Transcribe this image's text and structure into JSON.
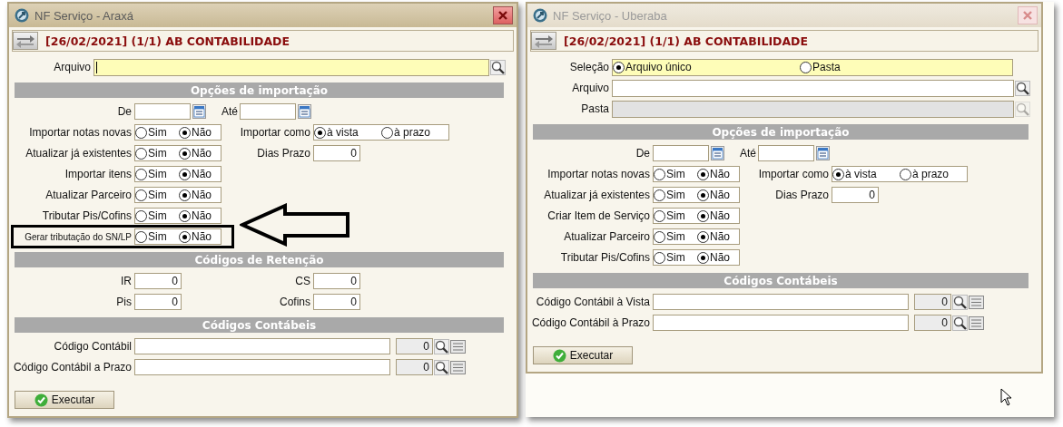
{
  "windows": [
    {
      "title": "NF Serviço - Araxá",
      "active": true,
      "header": "[26/02/2021] (1/1) AB CONTABILIDADE",
      "top_rows": [
        {
          "kind": "file",
          "label": "Arquivo",
          "highlighted": true,
          "disabled": false
        }
      ],
      "sections": [
        {
          "title": "Opções de importação",
          "rows": [
            {
              "boxed": false,
              "cells": [
                {
                  "kind": "date",
                  "label": "De"
                },
                {
                  "kind": "date",
                  "label": "Até"
                }
              ]
            },
            {
              "boxed": false,
              "cells": [
                {
                  "kind": "radio",
                  "label": "Importar notas novas",
                  "options": [
                    {
                      "label": "Sim",
                      "selected": false
                    },
                    {
                      "label": "Não",
                      "selected": true
                    }
                  ]
                },
                {
                  "kind": "radio",
                  "label": "Importar como",
                  "options": [
                    {
                      "label": "à vista",
                      "selected": true
                    },
                    {
                      "label": "à prazo",
                      "selected": false
                    }
                  ]
                }
              ]
            },
            {
              "boxed": false,
              "cells": [
                {
                  "kind": "radio",
                  "label": "Atualizar já existentes",
                  "options": [
                    {
                      "label": "Sim",
                      "selected": false
                    },
                    {
                      "label": "Não",
                      "selected": true
                    }
                  ]
                },
                {
                  "kind": "number",
                  "label": "Dias Prazo",
                  "value": "0"
                }
              ]
            },
            {
              "boxed": false,
              "cells": [
                {
                  "kind": "radio",
                  "label": "Importar itens",
                  "options": [
                    {
                      "label": "Sim",
                      "selected": false
                    },
                    {
                      "label": "Não",
                      "selected": true
                    }
                  ]
                }
              ]
            },
            {
              "boxed": false,
              "cells": [
                {
                  "kind": "radio",
                  "label": "Atualizar Parceiro",
                  "options": [
                    {
                      "label": "Sim",
                      "selected": false
                    },
                    {
                      "label": "Não",
                      "selected": true
                    }
                  ]
                }
              ]
            },
            {
              "boxed": false,
              "cells": [
                {
                  "kind": "radio",
                  "label": "Tributar Pis/Cofins",
                  "options": [
                    {
                      "label": "Sim",
                      "selected": false
                    },
                    {
                      "label": "Não",
                      "selected": true
                    }
                  ]
                }
              ]
            },
            {
              "boxed": true,
              "cells": [
                {
                  "kind": "radio",
                  "label": "Gerar tributação do SN/LP",
                  "options": [
                    {
                      "label": "Sim",
                      "selected": false
                    },
                    {
                      "label": "Não",
                      "selected": true
                    }
                  ]
                }
              ]
            }
          ]
        },
        {
          "title": "Códigos de Retenção",
          "rows": [
            {
              "boxed": false,
              "cells": [
                {
                  "kind": "number",
                  "label": "IR",
                  "value": "0"
                },
                {
                  "kind": "number",
                  "label": "CS",
                  "value": "0"
                }
              ]
            },
            {
              "boxed": false,
              "cells": [
                {
                  "kind": "number",
                  "label": "Pis",
                  "value": "0"
                },
                {
                  "kind": "number",
                  "label": "Cofins",
                  "value": "0"
                }
              ]
            }
          ]
        },
        {
          "title": "Códigos Contábeis",
          "rows": [
            {
              "boxed": false,
              "cells": [
                {
                  "kind": "account",
                  "label": "Código Contábil",
                  "code": "0"
                }
              ]
            },
            {
              "boxed": false,
              "cells": [
                {
                  "kind": "account",
                  "label": "Código Contábil a Prazo",
                  "code": "0"
                }
              ]
            }
          ]
        }
      ],
      "button": "Executar"
    },
    {
      "title": "NF Serviço - Uberaba",
      "active": false,
      "header": "[26/02/2021] (1/1) AB CONTABILIDADE",
      "top_rows": [
        {
          "kind": "selection",
          "label": "Seleção",
          "options": [
            {
              "label": "Arquivo único",
              "selected": true
            },
            {
              "label": "Pasta",
              "selected": false
            }
          ]
        },
        {
          "kind": "file",
          "label": "Arquivo",
          "highlighted": false,
          "disabled": false
        },
        {
          "kind": "file",
          "label": "Pasta",
          "highlighted": false,
          "disabled": true
        }
      ],
      "sections": [
        {
          "title": "Opções de importação",
          "rows": [
            {
              "boxed": false,
              "cells": [
                {
                  "kind": "date",
                  "label": "De"
                },
                {
                  "kind": "date",
                  "label": "Até"
                }
              ]
            },
            {
              "boxed": false,
              "cells": [
                {
                  "kind": "radio",
                  "label": "Importar notas novas",
                  "options": [
                    {
                      "label": "Sim",
                      "selected": false
                    },
                    {
                      "label": "Não",
                      "selected": true
                    }
                  ]
                },
                {
                  "kind": "radio",
                  "label": "Importar como",
                  "options": [
                    {
                      "label": "à vista",
                      "selected": true
                    },
                    {
                      "label": "à prazo",
                      "selected": false
                    }
                  ]
                }
              ]
            },
            {
              "boxed": false,
              "cells": [
                {
                  "kind": "radio",
                  "label": "Atualizar já existentes",
                  "options": [
                    {
                      "label": "Sim",
                      "selected": false
                    },
                    {
                      "label": "Não",
                      "selected": true
                    }
                  ]
                },
                {
                  "kind": "number",
                  "label": "Dias Prazo",
                  "value": "0"
                }
              ]
            },
            {
              "boxed": false,
              "cells": [
                {
                  "kind": "radio",
                  "label": "Criar Item de Serviço",
                  "options": [
                    {
                      "label": "Sim",
                      "selected": false
                    },
                    {
                      "label": "Não",
                      "selected": true
                    }
                  ]
                }
              ]
            },
            {
              "boxed": false,
              "cells": [
                {
                  "kind": "radio",
                  "label": "Atualizar Parceiro",
                  "options": [
                    {
                      "label": "Sim",
                      "selected": false
                    },
                    {
                      "label": "Não",
                      "selected": true
                    }
                  ]
                }
              ]
            },
            {
              "boxed": false,
              "cells": [
                {
                  "kind": "radio",
                  "label": "Tributar Pis/Cofins",
                  "options": [
                    {
                      "label": "Sim",
                      "selected": false
                    },
                    {
                      "label": "Não",
                      "selected": true
                    }
                  ]
                }
              ]
            }
          ]
        },
        {
          "title": "Códigos Contábeis",
          "rows": [
            {
              "boxed": false,
              "cells": [
                {
                  "kind": "account",
                  "label": "Código Contábil à Vista",
                  "code": "0"
                }
              ]
            },
            {
              "boxed": false,
              "cells": [
                {
                  "kind": "account",
                  "label": "Código Contábil à Prazo",
                  "code": "0"
                }
              ]
            }
          ]
        }
      ],
      "button": "Executar"
    }
  ]
}
